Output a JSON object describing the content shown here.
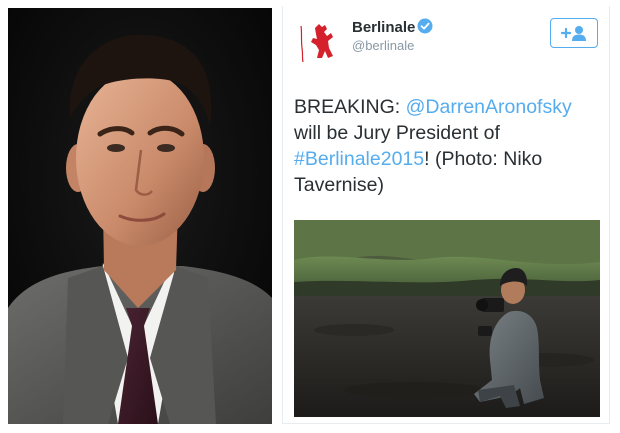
{
  "tweet": {
    "display_name": "Berlinale",
    "handle": "@berlinale",
    "text_parts": {
      "prefix": "BREAKING: ",
      "mention": "@DarrenAronofsky",
      "middle": " will be Jury President of ",
      "hashtag": "#Berlinale2015",
      "suffix": "! (Photo: Niko Tavernise)"
    },
    "verified_icon": "verified-badge-icon",
    "follow_icon": "add-user-icon"
  },
  "colors": {
    "link": "#55acee",
    "text": "#292f33",
    "muted": "#8899a6",
    "brand_red": "#d4212c"
  }
}
